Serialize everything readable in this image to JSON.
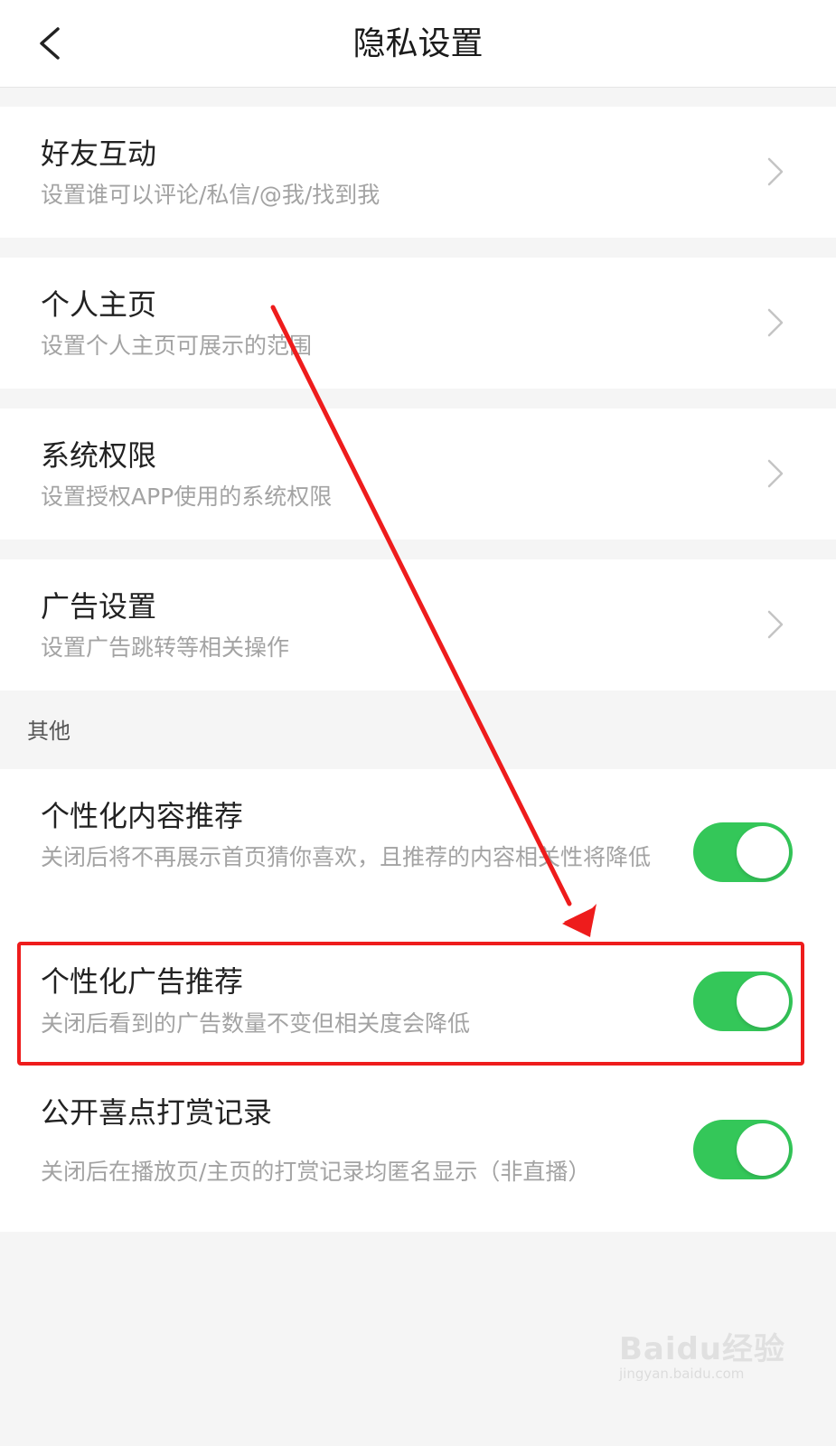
{
  "header": {
    "title": "隐私设置"
  },
  "settings": [
    {
      "title": "好友互动",
      "subtitle": "设置谁可以评论/私信/@我/找到我"
    },
    {
      "title": "个人主页",
      "subtitle": "设置个人主页可展示的范围"
    },
    {
      "title": "系统权限",
      "subtitle": "设置授权APP使用的系统权限"
    },
    {
      "title": "广告设置",
      "subtitle": "设置广告跳转等相关操作"
    }
  ],
  "others": {
    "section_label": "其他",
    "items": [
      {
        "title": "个性化内容推荐",
        "subtitle": "关闭后将不再展示首页猜你喜欢，且推荐的内容相关性将降低",
        "enabled": true
      },
      {
        "title": "个性化广告推荐",
        "subtitle": "关闭后看到的广告数量不变但相关度会降低",
        "enabled": true
      },
      {
        "title": "公开喜点打赏记录",
        "subtitle": "关闭后在播放页/主页的打赏记录均匿名显示（非直播）",
        "enabled": true
      }
    ]
  },
  "colors": {
    "toggle_on": "#34c759",
    "annotation": "#ee1c1c"
  },
  "watermark": {
    "logo_text": "Baidu经验",
    "url": "jingyan.baidu.com"
  }
}
